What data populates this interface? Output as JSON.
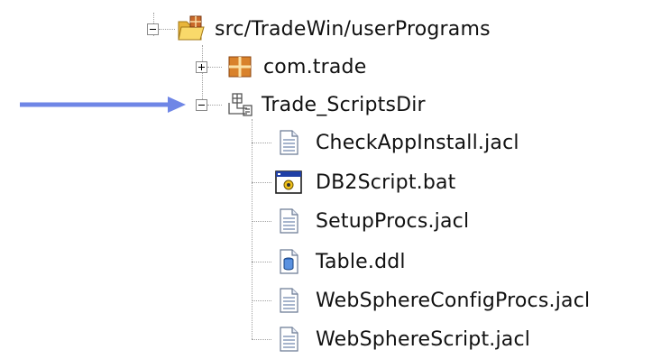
{
  "tree": {
    "root": {
      "label": "src/TradeWin/userPrograms",
      "icon": "source-folder-icon",
      "expanded": true
    },
    "children": [
      {
        "label": "com.trade",
        "icon": "package-icon",
        "expanded": false
      },
      {
        "label": "Trade_ScriptsDir",
        "icon": "folder-package-icon",
        "expanded": true,
        "children": [
          {
            "label": "CheckAppInstall.jacl",
            "icon": "text-file-icon"
          },
          {
            "label": "DB2Script.bat",
            "icon": "batch-file-icon"
          },
          {
            "label": "SetupProcs.jacl",
            "icon": "text-file-icon"
          },
          {
            "label": "Table.ddl",
            "icon": "database-file-icon"
          },
          {
            "label": "WebSphereConfigProcs.jacl",
            "icon": "text-file-icon"
          },
          {
            "label": "WebSphereScript.jacl",
            "icon": "text-file-icon"
          }
        ]
      }
    ]
  },
  "colors": {
    "arrow": "#6f86e6",
    "connector": "#a0a0a0",
    "folder": "#f5c542",
    "package": "#d9822b"
  }
}
